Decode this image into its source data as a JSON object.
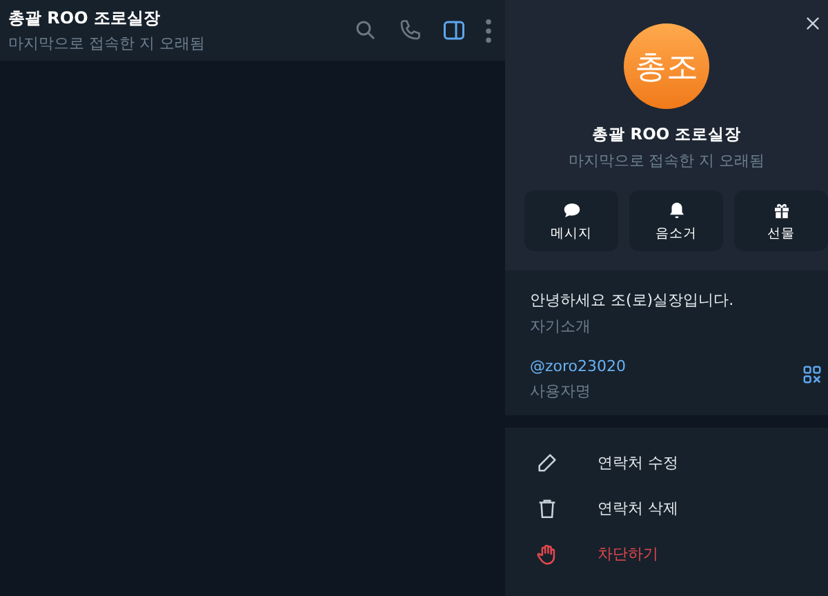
{
  "chat_header": {
    "title": "총괄 ROO 조로실장",
    "status": "마지막으로 접속한 지 오래됨",
    "icons": [
      {
        "kind": "search",
        "selected": false
      },
      {
        "kind": "call",
        "selected": false
      },
      {
        "kind": "panel",
        "selected": true
      },
      {
        "kind": "more",
        "selected": false
      }
    ]
  },
  "profile": {
    "avatar_initials": "총조",
    "name": "총괄 ROO 조로실장",
    "status": "마지막으로 접속한 지 오래됨",
    "actions": [
      {
        "kind": "message",
        "label": "메시지"
      },
      {
        "kind": "mute",
        "label": "음소거"
      },
      {
        "kind": "gift",
        "label": "선물"
      }
    ],
    "bio": {
      "value": "안녕하세요 조(로)실장입니다.",
      "caption": "자기소개"
    },
    "username": {
      "value": "@zoro23020",
      "caption": "사용자명"
    },
    "menu": [
      {
        "kind": "edit",
        "label": "연락처 수정",
        "danger": false
      },
      {
        "kind": "delete",
        "label": "연락처 삭제",
        "danger": false
      },
      {
        "kind": "block",
        "label": "차단하기",
        "danger": true
      }
    ]
  }
}
